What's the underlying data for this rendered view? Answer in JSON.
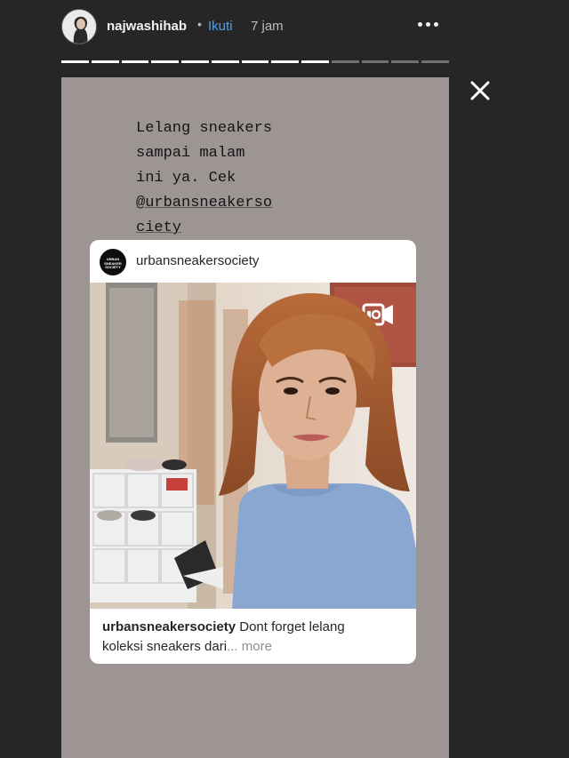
{
  "header": {
    "username": "najwashihab",
    "separator": "•",
    "follow_label": "Ikuti",
    "time_ago": "7 jam"
  },
  "progress": {
    "total_segments": 13,
    "completed_segments": 9
  },
  "story": {
    "caption_lines": [
      "Lelang sneakers",
      "sampai malam",
      "ini ya. Cek",
      "@urbansneakerso",
      "ciety"
    ],
    "post": {
      "username": "urbansneakersociety",
      "logo_text": "URBAN SNEAKER SOCIETY",
      "caption_user": "urbansneakersociety",
      "caption_text_1": " Dont forget lelang",
      "caption_text_2": "koleksi sneakers dari",
      "more_label": "... more"
    }
  },
  "colors": {
    "background": "#262626",
    "story_bg": "#9d9593",
    "follow": "#4aa3f0",
    "card": "#ffffff"
  },
  "icons": [
    "more-options-icon",
    "close-icon",
    "video-icon"
  ]
}
